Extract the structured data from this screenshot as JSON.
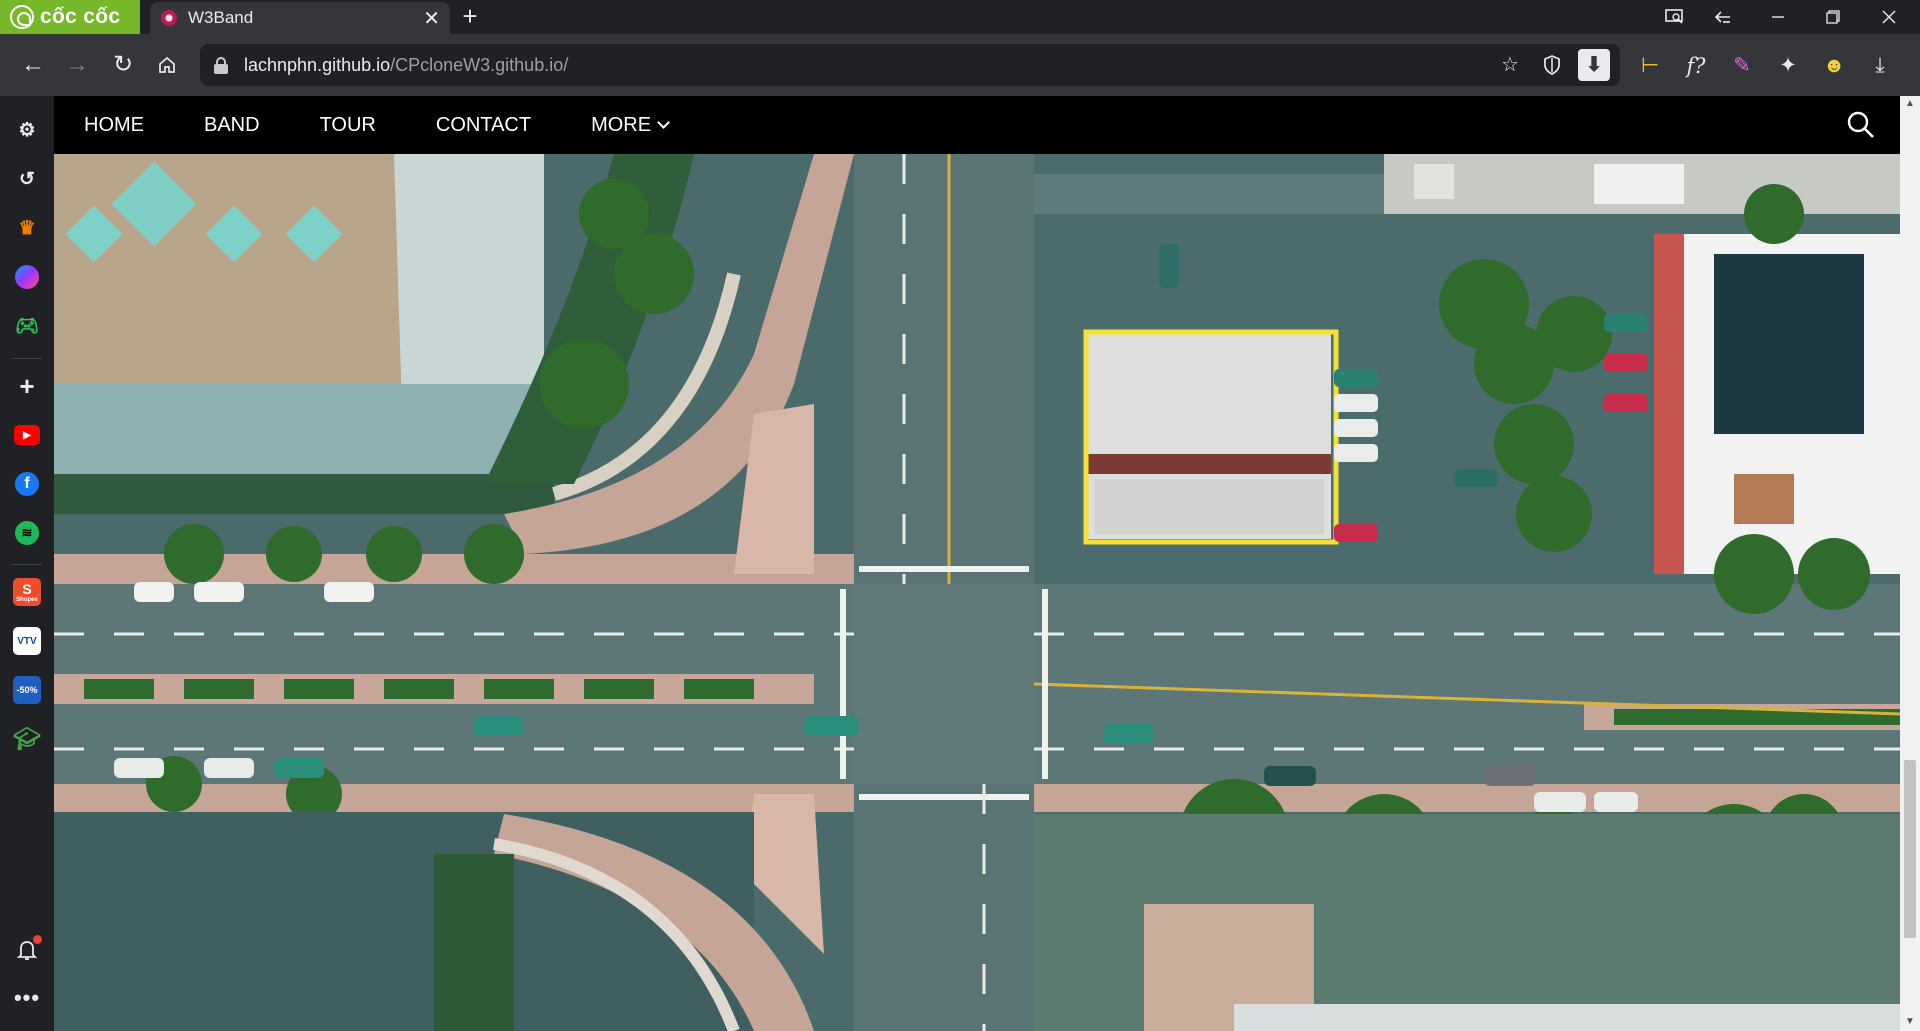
{
  "browser": {
    "brand": "cốc cốc",
    "tab_title": "W3Band",
    "url_host": "lachnphn.github.io",
    "url_path": "/CPcloneW3.github.io/",
    "window_controls": [
      "screen-search-icon",
      "back-arrow-icon",
      "minimize-icon",
      "restore-icon",
      "close-icon"
    ],
    "ext_icons": [
      "translate-icon",
      "formula-icon",
      "color-picker-icon",
      "puzzle-icon",
      "avatar-icon",
      "download-icon"
    ],
    "notification_count_dot": true
  },
  "sidebar": {
    "items": [
      "settings-icon",
      "history-icon",
      "crown-icon",
      "messenger-icon",
      "gamepad-icon",
      "plus-icon",
      "youtube-icon",
      "facebook-icon",
      "spotify-icon",
      "shopee-icon",
      "vtv-icon",
      "voucher-icon",
      "grad-hat-icon",
      "bell-icon",
      "more-icon"
    ],
    "shopee_label": "Shopee",
    "vtv_label": "VTV",
    "voucher_label": "-50%"
  },
  "nav": {
    "home": "HOME",
    "band": "BAND",
    "tour": "TOUR",
    "contact": "CONTACT",
    "more": "MORE"
  },
  "colors": {
    "nav_bg": "#000000",
    "brand_green": "#76b82a",
    "highlight_box": "#f3e132"
  }
}
